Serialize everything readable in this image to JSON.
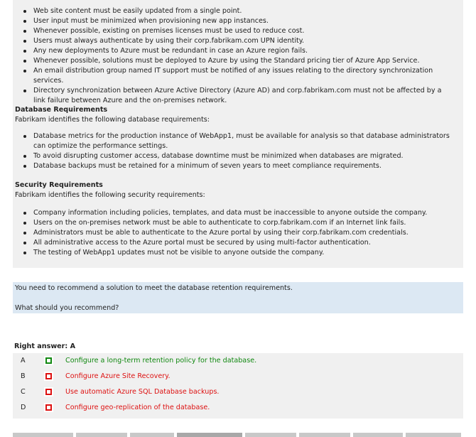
{
  "top_requirements": [
    "Web site content must be easily updated from a single point.",
    "User input must be minimized when provisioning new app instances.",
    "Whenever possible, existing on premises licenses must be used to reduce cost.",
    "Users must always authenticate by using their corp.fabrikam.com UPN identity.",
    "Any new deployments to Azure must be redundant in case an Azure region fails.",
    "Whenever possible, solutions must be deployed to Azure by using the Standard pricing tier of Azure App Service.",
    "An email distribution group named IT support must be notified of any issues relating to the directory synchronization services.",
    "Directory synchronization between Azure Active Directory (Azure AD) and corp.fabrikam.com must not be affected by a link failure between Azure and the on-premises network."
  ],
  "database": {
    "heading": "Database Requirements",
    "intro": "Fabrikam identifies the following database requirements:",
    "items": [
      "Database metrics for the production instance of WebApp1, must be available for analysis so that database administrators can optimize the performance settings.",
      "To avoid disrupting customer access, database downtime must be minimized when databases are migrated.",
      "Database backups must be retained for a minimum of seven years to meet compliance requirements."
    ]
  },
  "security": {
    "heading": "Security Requirements",
    "intro": "Fabrikam identifies the following security requirements:",
    "items": [
      "Company information including policies, templates, and data must be inaccessible to anyone outside the company.",
      "Users on the on-premises network must be able to authenticate to corp.fabrikam.com if an Internet link fails.",
      "Administrators must be able to authenticate to the Azure portal by using their corp.fabrikam.com credentials.",
      "All administrative access to the Azure portal must be secured by using multi-factor authentication.",
      "The testing of WebApp1 updates must not be visible to anyone outside the company."
    ]
  },
  "question": {
    "line1": "You need to recommend a solution to meet the database retention requirements.",
    "line2": "What should you recommend?"
  },
  "answer": {
    "label": "Right answer: A",
    "correct_color": "#118811",
    "wrong_color": "#dd1111",
    "options": [
      {
        "letter": "A",
        "text": "Configure a long-term retention policy for the database.",
        "correct": true
      },
      {
        "letter": "B",
        "text": "Configure Azure Site Recovery.",
        "correct": false
      },
      {
        "letter": "C",
        "text": "Use automatic Azure SQL Database backups.",
        "correct": false
      },
      {
        "letter": "D",
        "text": "Configure geo-replication of the database.",
        "correct": false
      }
    ]
  }
}
